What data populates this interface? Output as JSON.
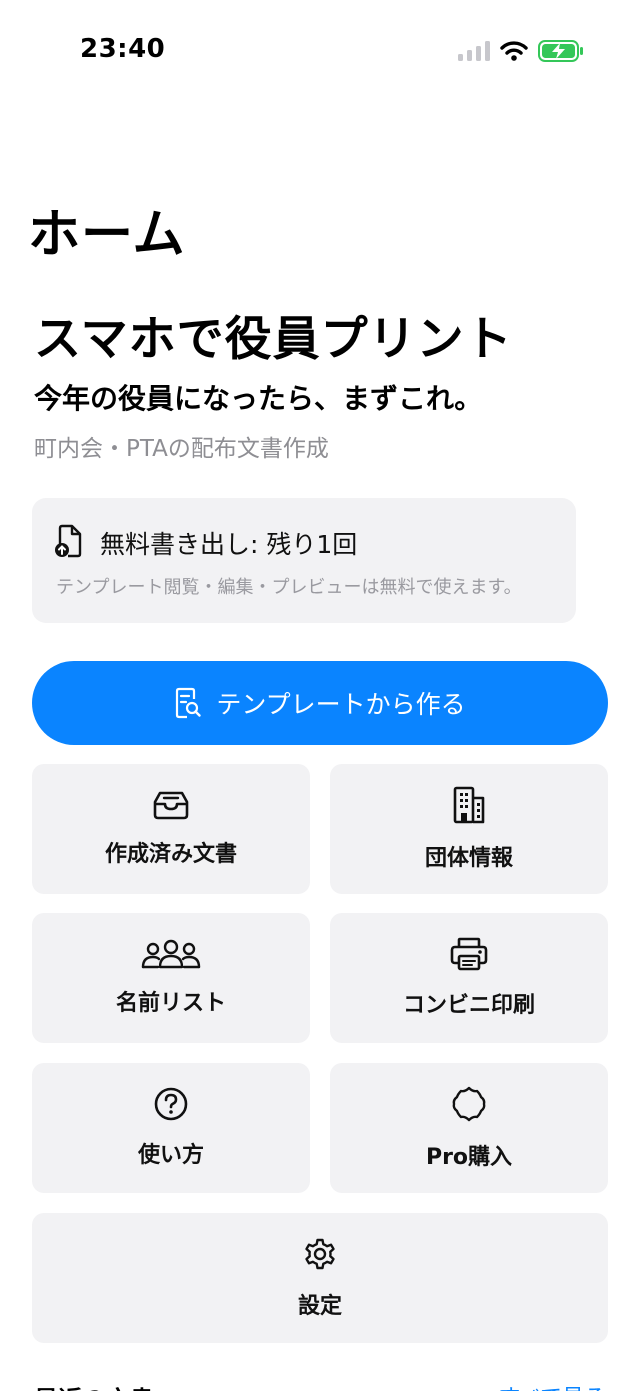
{
  "status_bar": {
    "time": "23:40"
  },
  "nav": {
    "title": "ホーム"
  },
  "hero": {
    "title": "スマホで役員プリント",
    "subtitle": "今年の役員になったら、まずこれ。",
    "caption": "町内会・PTAの配布文書作成"
  },
  "quota": {
    "text": "無料書き出し: 残り1回",
    "note": "テンプレート閲覧・編集・プレビューは無料で使えます。",
    "icon": "document-upload-icon"
  },
  "primary_action": {
    "label": "テンプレートから作る",
    "icon": "document-search-icon"
  },
  "tiles": [
    {
      "label": "作成済み文書",
      "icon": "tray-icon"
    },
    {
      "label": "団体情報",
      "icon": "building-icon"
    },
    {
      "label": "名前リスト",
      "icon": "people-icon"
    },
    {
      "label": "コンビニ印刷",
      "icon": "printer-icon"
    },
    {
      "label": "使い方",
      "icon": "question-icon"
    },
    {
      "label": "Pro購入",
      "icon": "seal-icon"
    },
    {
      "label": "設定",
      "icon": "gear-icon"
    }
  ],
  "recent": {
    "title": "最近の文書",
    "see_all": "すべて見る"
  },
  "colors": {
    "accent": "#0a84ff",
    "tile_bg": "#f2f2f4",
    "battery": "#34c759"
  }
}
